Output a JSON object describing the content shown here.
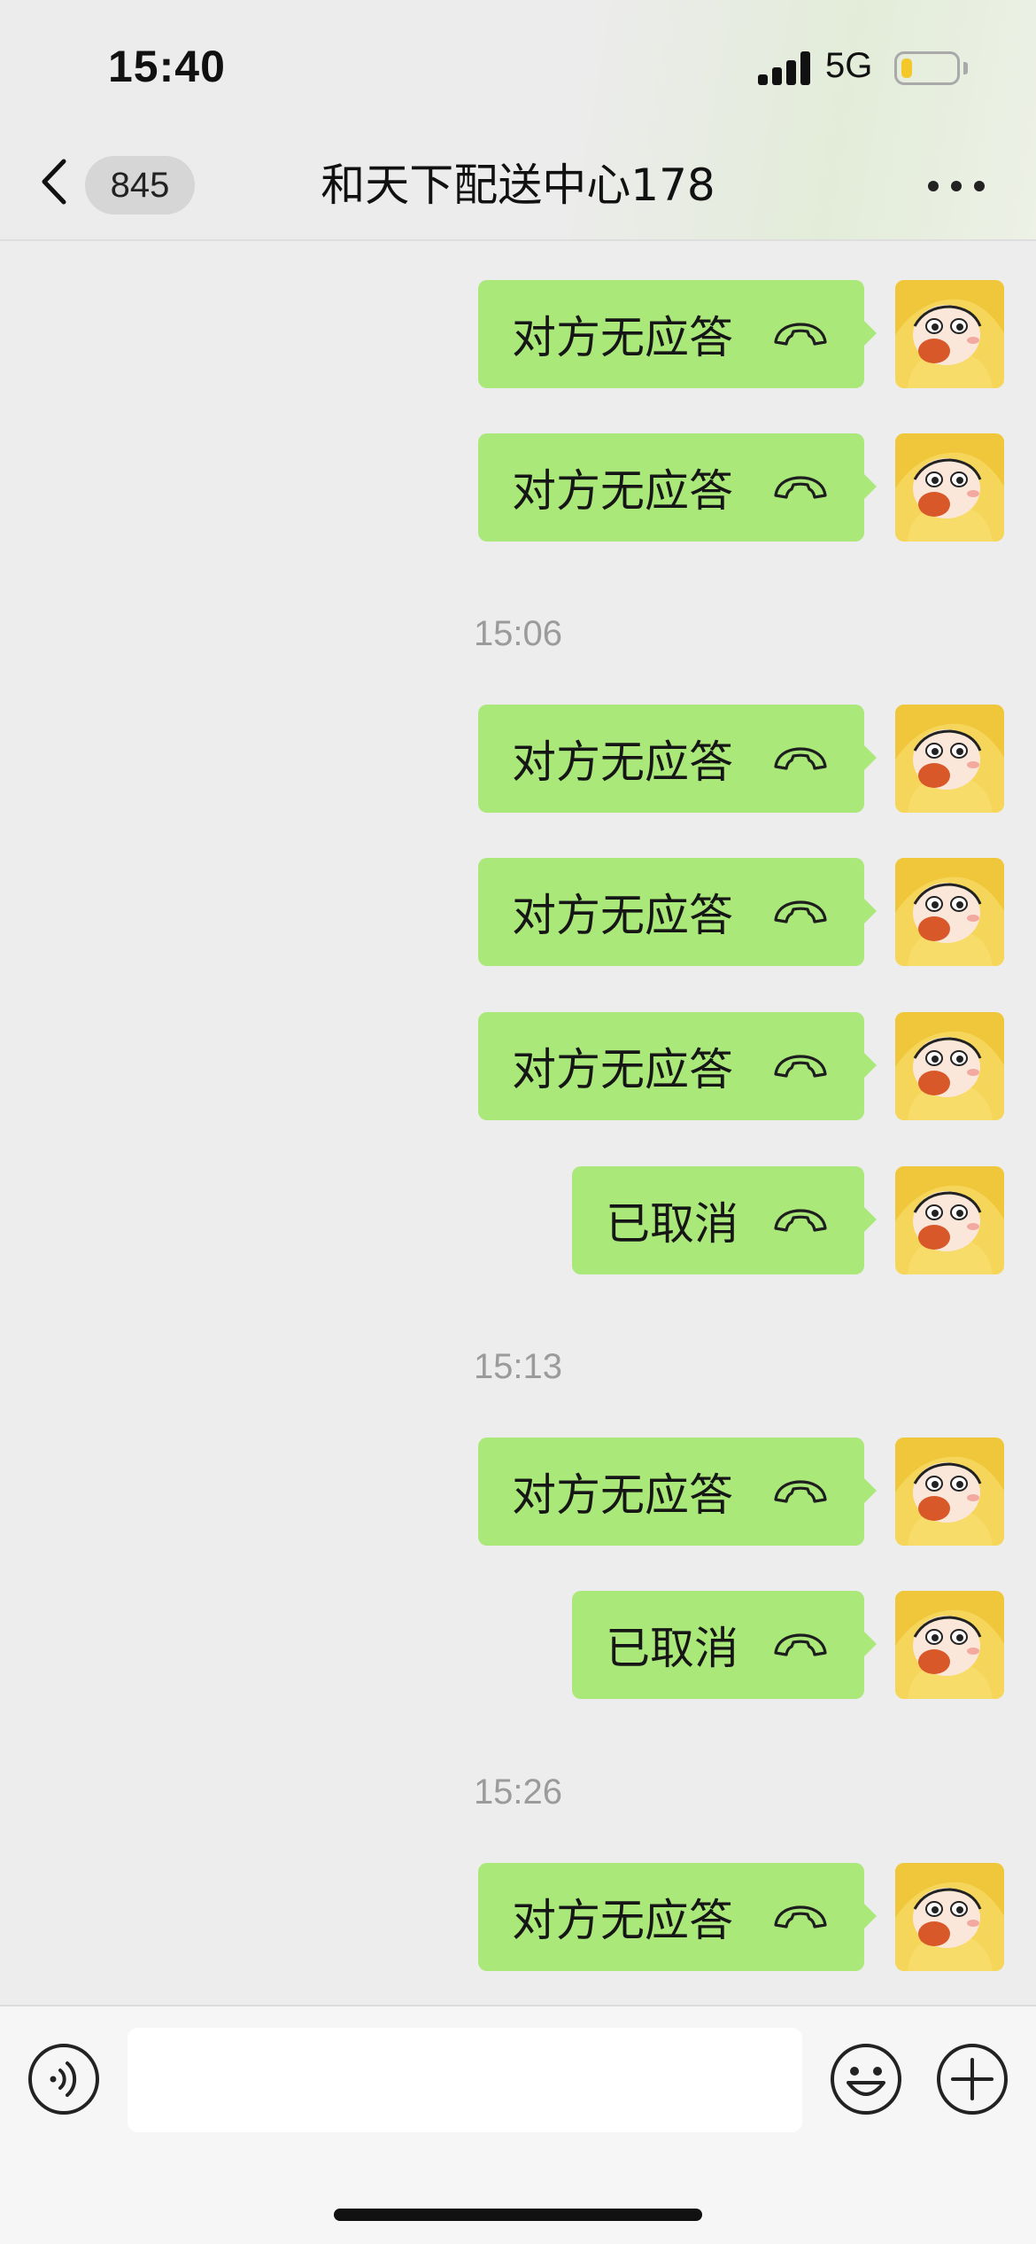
{
  "status_bar": {
    "time": "15:40",
    "network": "5G",
    "battery_level": 0.2
  },
  "header": {
    "unread_count": "845",
    "title": "和天下配送中心178"
  },
  "messages": [
    {
      "type": "call",
      "text": "对方无应答"
    },
    {
      "type": "call",
      "text": "对方无应答"
    },
    {
      "type": "time",
      "text": "15:06"
    },
    {
      "type": "call",
      "text": "对方无应答"
    },
    {
      "type": "call",
      "text": "对方无应答"
    },
    {
      "type": "call",
      "text": "对方无应答"
    },
    {
      "type": "call",
      "text": "已取消"
    },
    {
      "type": "time",
      "text": "15:13"
    },
    {
      "type": "call",
      "text": "对方无应答"
    },
    {
      "type": "call",
      "text": "已取消"
    },
    {
      "type": "time",
      "text": "15:26"
    },
    {
      "type": "call",
      "text": "对方无应答"
    }
  ],
  "icons": {
    "back": "chevron-left-icon",
    "more": "more-dots-icon",
    "call": "phone-hangup-icon",
    "voice": "voice-icon",
    "emoji": "emoji-icon",
    "plus": "plus-icon"
  },
  "colors": {
    "bubble": "#a9e879",
    "background": "#ededed"
  }
}
